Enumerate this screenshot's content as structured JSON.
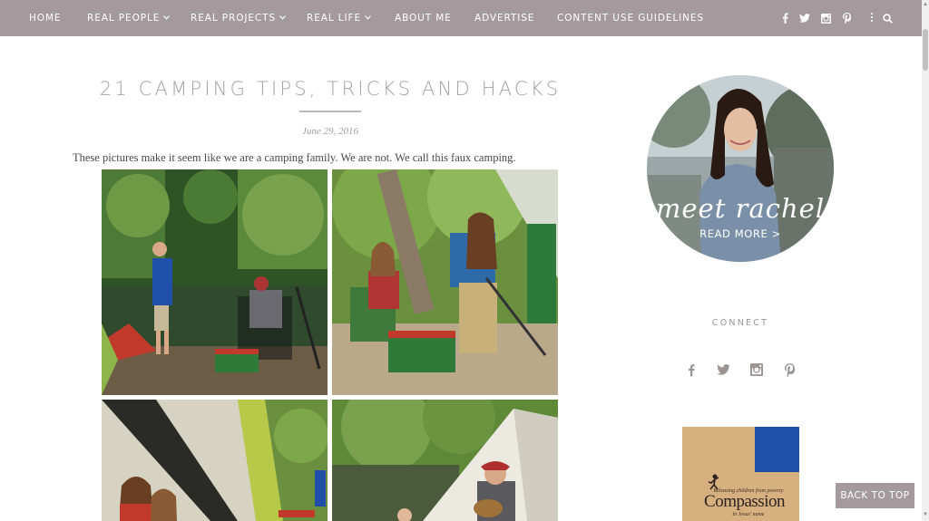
{
  "nav": {
    "items": [
      {
        "label": "HOME",
        "has_dropdown": false
      },
      {
        "label": "REAL PEOPLE",
        "has_dropdown": true
      },
      {
        "label": "REAL PROJECTS",
        "has_dropdown": true
      },
      {
        "label": "REAL LIFE",
        "has_dropdown": true
      },
      {
        "label": "ABOUT ME",
        "has_dropdown": false
      },
      {
        "label": "ADVERTISE",
        "has_dropdown": false
      },
      {
        "label": "CONTENT USE GUIDELINES",
        "has_dropdown": false
      }
    ],
    "caret": "⌄",
    "social_icons": [
      "facebook-icon",
      "twitter-icon",
      "instagram-icon",
      "pinterest-icon"
    ],
    "menu_icon": "vertical-dots-icon",
    "search_icon": "search-icon",
    "background_color": "#a49a9e"
  },
  "post": {
    "title": "21 CAMPING TIPS, TRICKS AND HACKS",
    "date": "June 29, 2016",
    "intro": "These pictures make it seem like we are a camping family. We are not. We call this faux camping.",
    "photos": [
      "boy-fishing-lake",
      "girls-at-campfire-table",
      "family-in-tent",
      "man-near-tent-lake"
    ]
  },
  "sidebar": {
    "about_script": "meet rachel",
    "about_link": "READ MORE >",
    "connect_title": "CONNECT",
    "connect_icons": [
      "facebook-icon",
      "twitter-icon",
      "instagram-icon",
      "pinterest-icon"
    ],
    "ad": {
      "tagline": "Releasing children from poverty",
      "brand": "Compassion",
      "subline": "in Jesus' name"
    }
  },
  "back_to_top": "BACK TO TOP"
}
